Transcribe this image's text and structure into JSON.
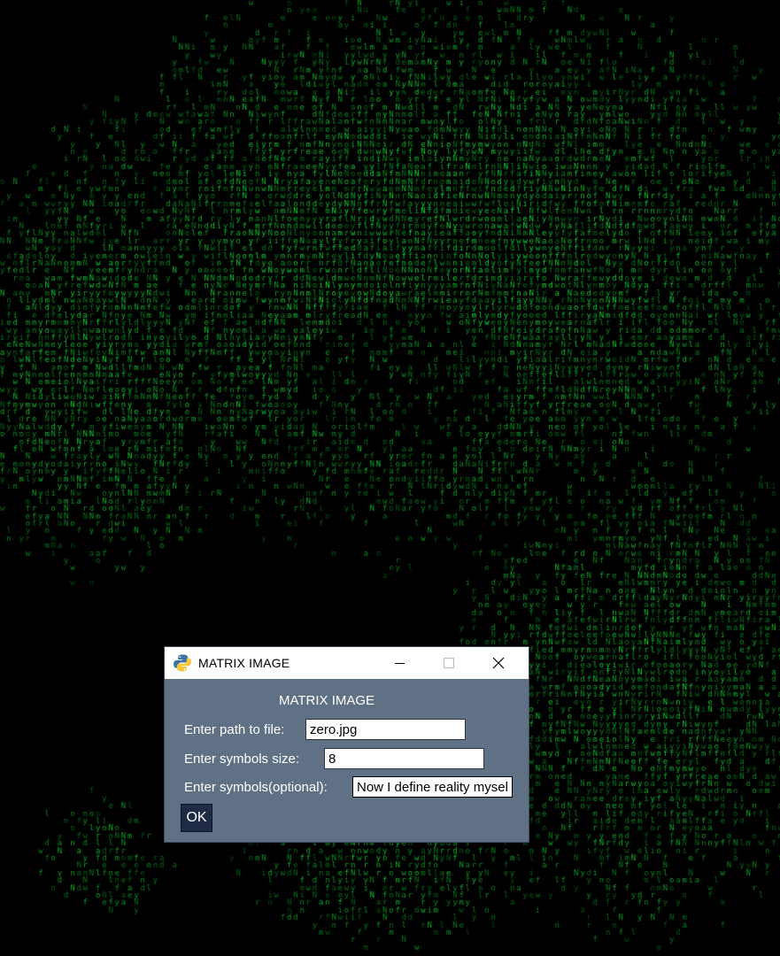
{
  "background": {
    "glyphs": "eyanNwfdlNfyormi",
    "color": "#16e03a"
  },
  "window": {
    "title": "MATRIX IMAGE",
    "icon": "python-icon",
    "controls": {
      "minimize": "minimize-icon",
      "maximize": "maximize-icon",
      "close": "close-icon"
    }
  },
  "form": {
    "heading": "MATRIX IMAGE",
    "path_label": "Enter path to file:",
    "path_value": "zero.jpg",
    "size_label": "Enter symbols size:",
    "size_value": "8",
    "symbols_label": "Enter symbols(optional):",
    "symbols_value": "Now I define reality myself",
    "ok_label": "OK"
  }
}
